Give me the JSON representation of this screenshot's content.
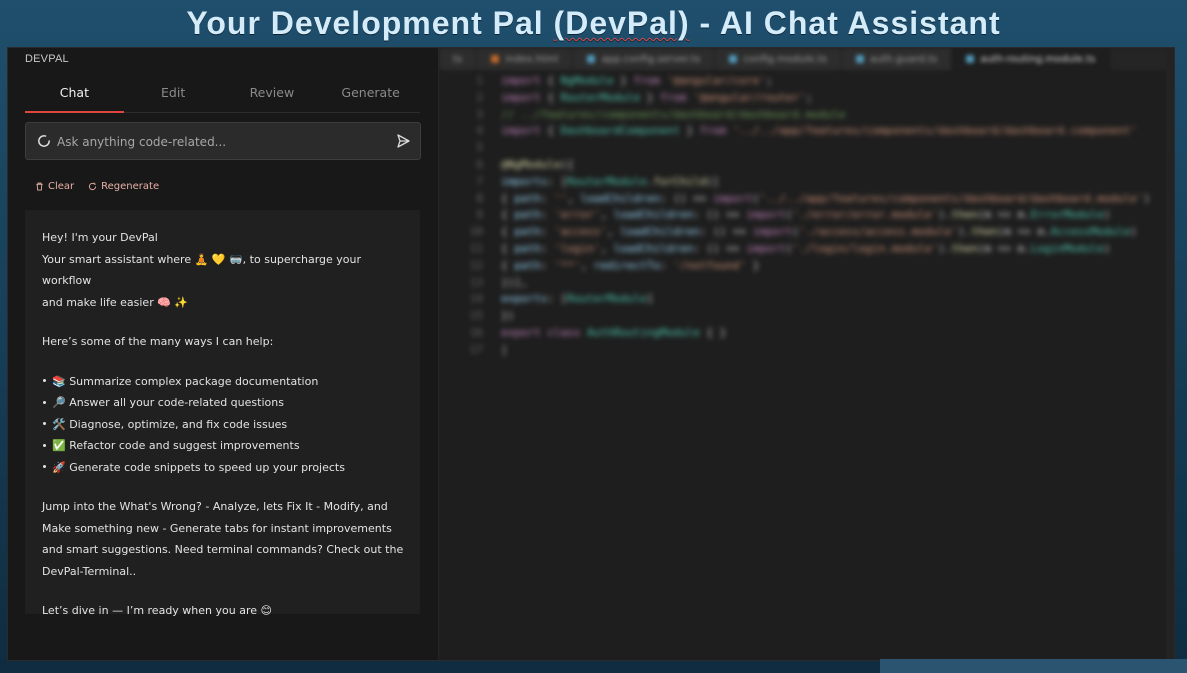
{
  "banner": {
    "title_before": "Your Development Pal ",
    "title_mark": "(DevPal)",
    "title_after": " - AI Chat Assistant"
  },
  "panel": {
    "title": "DEVPAL",
    "tabs": [
      {
        "label": "Chat",
        "active": true
      },
      {
        "label": "Edit",
        "active": false
      },
      {
        "label": "Review",
        "active": false
      },
      {
        "label": "Generate",
        "active": false
      }
    ],
    "ask": {
      "placeholder": "Ask anything code-related...",
      "value": ""
    },
    "actions": {
      "clear": "Clear",
      "regenerate": "Regenerate"
    },
    "message": {
      "line1": "Hey! I'm your DevPal",
      "line2": "Your smart assistant where 🧘 💛 🥽, to supercharge your workflow",
      "line3": "and make life easier 🧠 ✨",
      "intro": "Here’s some of the many ways I can help:",
      "bullets": [
        "📚 Summarize complex package documentation",
        "🔎 Answer all your code-related questions",
        "🛠️ Diagnose, optimize, and fix code issues",
        "✅ Refactor code and suggest improvements",
        "🚀 Generate code snippets to speed up your projects"
      ],
      "para1": "Jump into the What's Wrong? - Analyze, lets Fix It - Modify, and",
      "para2": "Make something new - Generate tabs for instant improvements",
      "para3": "and smart suggestions. Need terminal commands? Check out the",
      "para4": "DevPal-Terminal..",
      "closing": "Let’s dive in — I’m ready when you are 😊"
    }
  },
  "editor": {
    "tabs": [
      {
        "label": "ts",
        "active": false
      },
      {
        "label": "index.html",
        "active": false
      },
      {
        "label": "app.config.server.ts",
        "active": false
      },
      {
        "label": "config.module.ts",
        "active": false
      },
      {
        "label": "auth.guard.ts",
        "active": false
      },
      {
        "label": "auth-routing.module.ts",
        "active": true
      }
    ],
    "lines": [
      {
        "n": "1",
        "html": "<span class='kw'>import</span> <span class='pl'>{ </span><span class='cls'>NgModule</span><span class='pl'> } </span><span class='kw'>from</span> <span class='str'>'@angular/core'</span><span class='pl'>;</span>"
      },
      {
        "n": "2",
        "html": "<span class='kw'>import</span> <span class='pl'>{ </span><span class='cls'>RouterModule</span><span class='pl'> } </span><span class='kw'>from</span> <span class='str'>'@angular/router'</span><span class='pl'>;</span>"
      },
      {
        "n": "3",
        "html": "<span class='cmt'>// ../features/components/dashboard/dashboard.module</span>"
      },
      {
        "n": "4",
        "html": "<span class='kw'>import</span> <span class='pl'>{ </span><span class='cls'>DashboardComponent</span><span class='pl'> } </span><span class='kw'>from</span> <span class='str'>'../../app/features/components/dashboard/dashboard.component'</span>"
      },
      {
        "n": "5",
        "html": ""
      },
      {
        "n": "6",
        "html": "<span class='dec'>@NgModule</span><span class='pl'>({</span>"
      },
      {
        "n": "7",
        "html": "<span class='pl'>    </span><span class='ident'>imports</span><span class='pl'>: [</span><span class='cls'>RouterModule</span><span class='pl'>.</span><span class='fn'>forChild</span><span class='pl'>([</span>"
      },
      {
        "n": "8",
        "html": "<span class='pl'>        { </span><span class='ident'>path</span><span class='pl'>: </span><span class='str'>''</span><span class='pl'>, </span><span class='ident'>loadChildren</span><span class='pl'>: () =&gt; </span><span class='kw'>import</span><span class='pl'>(</span><span class='str'>'../../app/features/components/dashboard/dashboard.module'</span><span class='pl'>)</span>"
      },
      {
        "n": "9",
        "html": "<span class='pl'>        { </span><span class='ident'>path</span><span class='pl'>: </span><span class='str'>'error'</span><span class='pl'>, </span><span class='ident'>loadChildren</span><span class='pl'>: () =&gt; </span><span class='kw'>import</span><span class='pl'>(</span><span class='str'>'./error/error.module'</span><span class='pl'>).</span><span class='fn'>then</span><span class='pl'>(m =&gt; m.</span><span class='cls'>ErrorModule</span><span class='pl'>)</span>"
      },
      {
        "n": "10",
        "html": "<span class='pl'>        { </span><span class='ident'>path</span><span class='pl'>: </span><span class='str'>'access'</span><span class='pl'>, </span><span class='ident'>loadChildren</span><span class='pl'>: () =&gt; </span><span class='kw'>import</span><span class='pl'>(</span><span class='str'>'./access/access.module'</span><span class='pl'>).</span><span class='fn'>then</span><span class='pl'>(m =&gt; m.</span><span class='cls'>AccessModule</span><span class='pl'>)</span>"
      },
      {
        "n": "11",
        "html": "<span class='pl'>        { </span><span class='ident'>path</span><span class='pl'>: </span><span class='str'>'login'</span><span class='pl'>, </span><span class='ident'>loadChildren</span><span class='pl'>: () =&gt; </span><span class='kw'>import</span><span class='pl'>(</span><span class='str'>'./login/login.module'</span><span class='pl'>).</span><span class='fn'>then</span><span class='pl'>(m =&gt; m.</span><span class='cls'>LoginModule</span><span class='pl'>)</span>"
      },
      {
        "n": "12",
        "html": "<span class='pl'>        { </span><span class='ident'>path</span><span class='pl'>: </span><span class='str'>'**'</span><span class='pl'>, </span><span class='ident'>redirectTo</span><span class='pl'>: </span><span class='str'>'/notfound'</span><span class='pl'> }</span>"
      },
      {
        "n": "13",
        "html": "<span class='pl'>    ])],</span>"
      },
      {
        "n": "14",
        "html": "<span class='pl'>    </span><span class='ident'>exports</span><span class='pl'>: [</span><span class='cls'>RouterModule</span><span class='pl'>]</span>"
      },
      {
        "n": "15",
        "html": "<span class='pl'>})</span>"
      },
      {
        "n": "16",
        "html": "<span class='kw'>export</span> <span class='kw'>class</span> <span class='cls'>AuthRoutingModule</span><span class='pl'> { }</span>"
      },
      {
        "n": "17",
        "html": "<span class='pl'>|</span>"
      }
    ]
  },
  "colors": {
    "accent": "#e0453f",
    "banner_text": "#d4ecf9",
    "panel_bg": "#181818",
    "message_bg": "#202020"
  }
}
